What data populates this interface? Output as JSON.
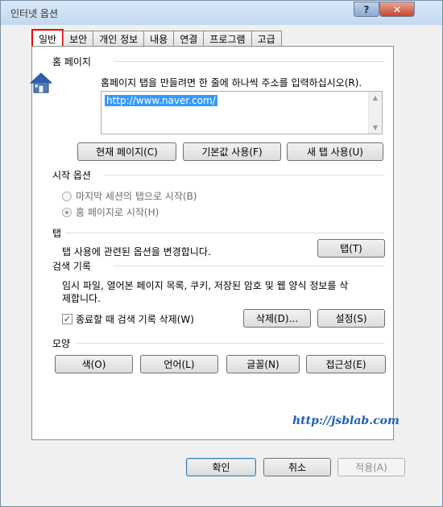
{
  "window": {
    "title": "인터넷 옵션",
    "help_label": "?",
    "close_label": "✕"
  },
  "tabs": [
    {
      "label": "일반",
      "active": true
    },
    {
      "label": "보안"
    },
    {
      "label": "개인 정보"
    },
    {
      "label": "내용"
    },
    {
      "label": "연결"
    },
    {
      "label": "프로그램"
    },
    {
      "label": "고급"
    }
  ],
  "home": {
    "section": "홈 페이지",
    "hint": "홈페이지 탭을 만들려면 한 줄에 하나씩 주소를 입력하십시오(R).",
    "url": "http://www.naver.com/",
    "buttons": {
      "current": "현재 페이지(C)",
      "default": "기본값 사용(F)",
      "new_tab": "새 탭 사용(U)"
    }
  },
  "startup": {
    "section": "시작 옵션",
    "option_last_session": "마지막 세션의 탭으로 시작(B)",
    "option_home": "홈 페이지로 시작(H)"
  },
  "tabs_section": {
    "section": "탭",
    "description": "탭 사용에 관련된 옵션을 변경합니다.",
    "button": "탭(T)"
  },
  "history": {
    "section": "검색 기록",
    "description_line1": "임시 파일, 열어본 페이지 목록, 쿠키, 저장된 암호 및 웹 양식 정보를 삭",
    "description_line2": "제합니다.",
    "checkbox_label": "종료할 때 검색 기록 삭제(W)",
    "delete_button": "삭제(D)...",
    "settings_button": "설정(S)"
  },
  "appearance": {
    "section": "모양",
    "colors": "색(O)",
    "languages": "언어(L)",
    "fonts": "글꼴(N)",
    "accessibility": "접근성(E)"
  },
  "watermark": "http://jsblab.com",
  "footer": {
    "ok": "확인",
    "cancel": "취소",
    "apply": "적용(A)"
  },
  "colors": {
    "accent_red": "#e00000",
    "selection": "#3399ff",
    "watermark": "#1f5fb8"
  }
}
